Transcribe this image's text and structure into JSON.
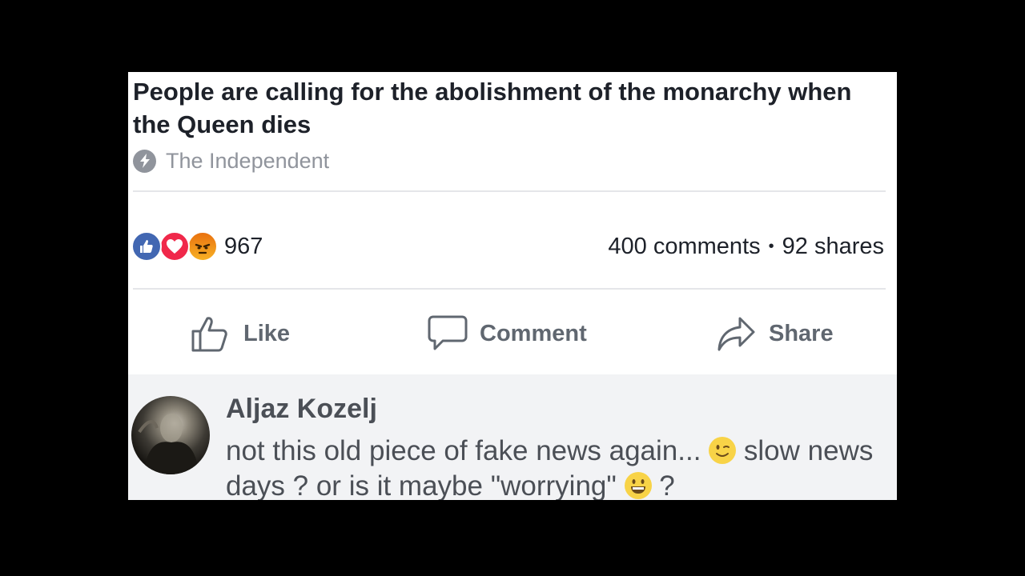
{
  "post": {
    "headline": "People are calling for the abolishment of the monarchy when the Queen dies",
    "source": "The Independent",
    "source_icon": "lightning-bolt-icon"
  },
  "stats": {
    "reactions": [
      "like",
      "love",
      "angry"
    ],
    "reaction_count": "967",
    "comments": "400 comments",
    "separator": "•",
    "shares": "92 shares"
  },
  "actions": {
    "like": "Like",
    "comment": "Comment",
    "share": "Share"
  },
  "comment": {
    "author": "Aljaz Kozelj",
    "text_part1": "not this old piece of fake news again...",
    "text_part2": "slow news days ? or is it maybe \"worrying\"",
    "text_part3": "?",
    "emoji1": "wink-emoji",
    "emoji2": "grin-emoji"
  },
  "colors": {
    "like": "#4267b2",
    "love": "#f0284a",
    "angry": "#f7b125"
  }
}
